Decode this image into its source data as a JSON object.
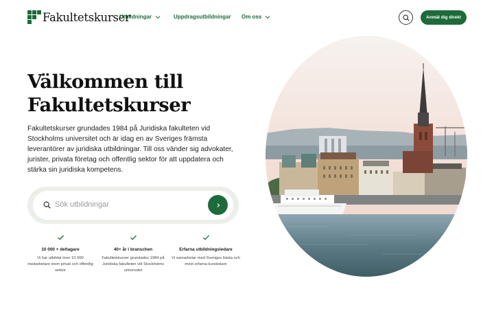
{
  "header": {
    "logo_text": "Fakultetskurser",
    "nav": [
      {
        "label": "Utbildningar",
        "has_dropdown": true
      },
      {
        "label": "Uppdragsutbildningar",
        "has_dropdown": false
      },
      {
        "label": "Om oss",
        "has_dropdown": true
      }
    ],
    "cta_label": "Anmäl dig direkt"
  },
  "hero": {
    "title_line1": "Välkommen till",
    "title_line2": "Fakultetskurser",
    "lead": "Fakultetskurser grundades 1984 på Juridiska fakulteten vid Stockholms universitet och är idag en av Sveriges främsta leverantörer av juridiska utbildningar. Till oss vänder sig advokater, jurister, privata företag och offentlig sektor för att uppdatera och stärka sin juridiska kompetens.",
    "search_placeholder": "Sök utbildningar"
  },
  "features": [
    {
      "title": "10 000 + deltagare",
      "desc": "Vi har utbildat över 10 000 medarbetare inom privat och offentlig sektor"
    },
    {
      "title": "40+ år i branschen",
      "desc": "Fakultetskurser grundades 1984 på Juridiska fakulteten vid Stockholms universitet"
    },
    {
      "title": "Erfarna utbildningsledare",
      "desc": "Vi samarbetar med Sveriges bästa och mest erfarna kursledare"
    }
  ],
  "colors": {
    "brand_green": "#1d6b3a",
    "search_bg": "#ecefe9"
  },
  "icons": [
    "logo-mark-icon",
    "chevron-down-icon",
    "search-icon",
    "chevron-right-icon",
    "check-icon"
  ]
}
